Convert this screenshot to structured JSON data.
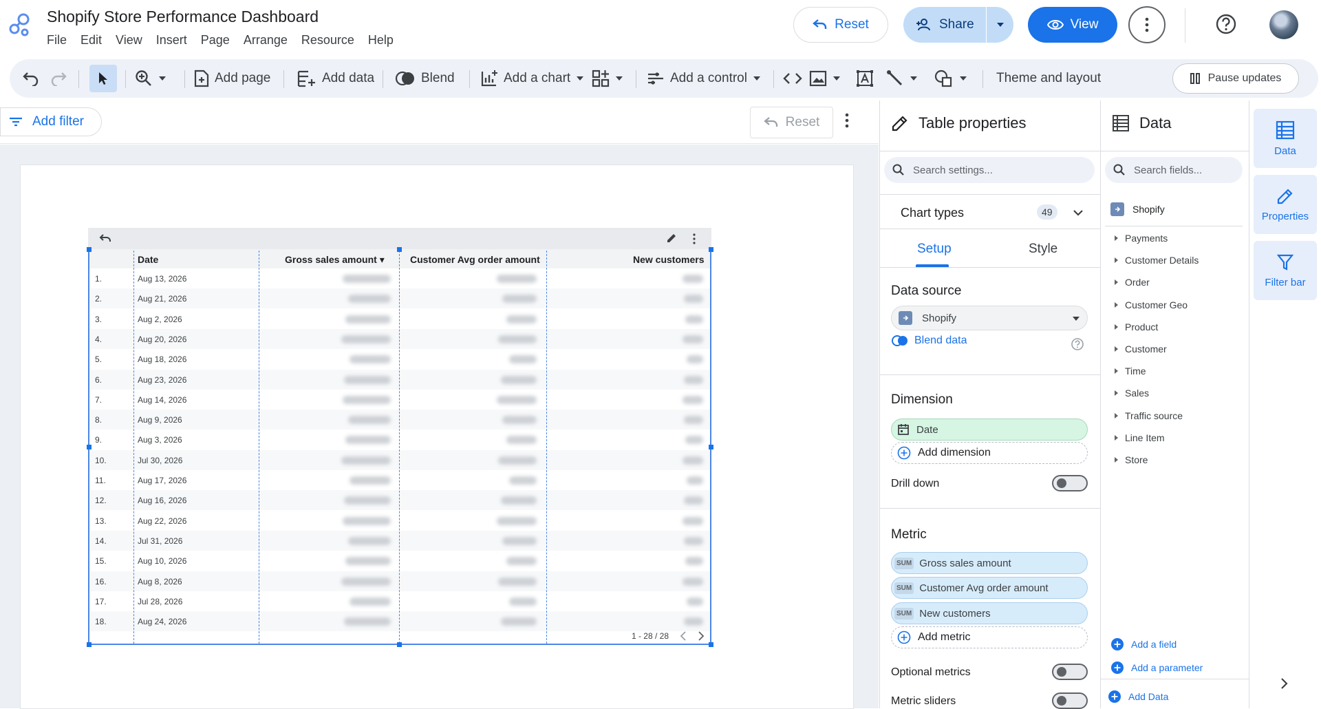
{
  "app": {
    "title": "Shopify Store Performance Dashboard",
    "menu": [
      "File",
      "Edit",
      "View",
      "Insert",
      "Page",
      "Arrange",
      "Resource",
      "Help"
    ]
  },
  "header_actions": {
    "reset_label": "Reset",
    "share_label": "Share",
    "view_label": "View"
  },
  "toolbar": {
    "add_page": "Add page",
    "add_data": "Add data",
    "blend": "Blend",
    "add_chart": "Add a chart",
    "add_control": "Add a control",
    "theme_layout": "Theme and layout",
    "pause_updates": "Pause updates"
  },
  "filterbar": {
    "add_filter": "Add filter",
    "reset_label": "Reset"
  },
  "table": {
    "columns": [
      "Date",
      "Gross sales amount",
      "Customer Avg order amount",
      "New customers"
    ],
    "sort_indicator": "▾",
    "rows": [
      {
        "num": "1.",
        "date": "Aug 13, 2026"
      },
      {
        "num": "2.",
        "date": "Aug 21, 2026"
      },
      {
        "num": "3.",
        "date": "Aug 2, 2026"
      },
      {
        "num": "4.",
        "date": "Aug 20, 2026"
      },
      {
        "num": "5.",
        "date": "Aug 18, 2026"
      },
      {
        "num": "6.",
        "date": "Aug 23, 2026"
      },
      {
        "num": "7.",
        "date": "Aug 14, 2026"
      },
      {
        "num": "8.",
        "date": "Aug 9, 2026"
      },
      {
        "num": "9.",
        "date": "Aug 3, 2026"
      },
      {
        "num": "10.",
        "date": "Jul 30, 2026"
      },
      {
        "num": "11.",
        "date": "Aug 17, 2026"
      },
      {
        "num": "12.",
        "date": "Aug 16, 2026"
      },
      {
        "num": "13.",
        "date": "Aug 22, 2026"
      },
      {
        "num": "14.",
        "date": "Jul 31, 2026"
      },
      {
        "num": "15.",
        "date": "Aug 10, 2026"
      },
      {
        "num": "16.",
        "date": "Aug 8, 2026"
      },
      {
        "num": "17.",
        "date": "Jul 28, 2026"
      },
      {
        "num": "18.",
        "date": "Aug 24, 2026"
      }
    ],
    "pagination": "1 - 28 / 28"
  },
  "properties": {
    "title": "Table properties",
    "search_placeholder": "Search settings...",
    "chart_types_label": "Chart types",
    "chart_types_count": "49",
    "tabs": [
      "Setup",
      "Style"
    ],
    "data_source_label": "Data source",
    "data_source_value": "Shopify",
    "blend_data": "Blend data",
    "dimension_label": "Dimension",
    "dimension_value": "Date",
    "add_dimension": "Add dimension",
    "drill_down": "Drill down",
    "metric_label": "Metric",
    "sum_tag": "SUM",
    "metrics": [
      "Gross sales amount",
      "Customer Avg order amount",
      "New customers"
    ],
    "add_metric": "Add metric",
    "optional_metrics": "Optional metrics",
    "metric_sliders": "Metric sliders"
  },
  "data_panel": {
    "title": "Data",
    "search_placeholder": "Search fields...",
    "source_name": "Shopify",
    "fields": [
      "Payments",
      "Customer Details",
      "Order",
      "Customer Geo",
      "Product",
      "Customer",
      "Time",
      "Sales",
      "Traffic source",
      "Line Item",
      "Store"
    ],
    "add_field": "Add a field",
    "add_parameter": "Add a parameter",
    "add_data": "Add Data"
  },
  "rail": {
    "data": "Data",
    "properties": "Properties",
    "filter_bar": "Filter bar"
  },
  "colors": {
    "accent": "#1a73e8",
    "dimension_chip": "#d6f5e3",
    "metric_chip": "#d7ecfb"
  }
}
